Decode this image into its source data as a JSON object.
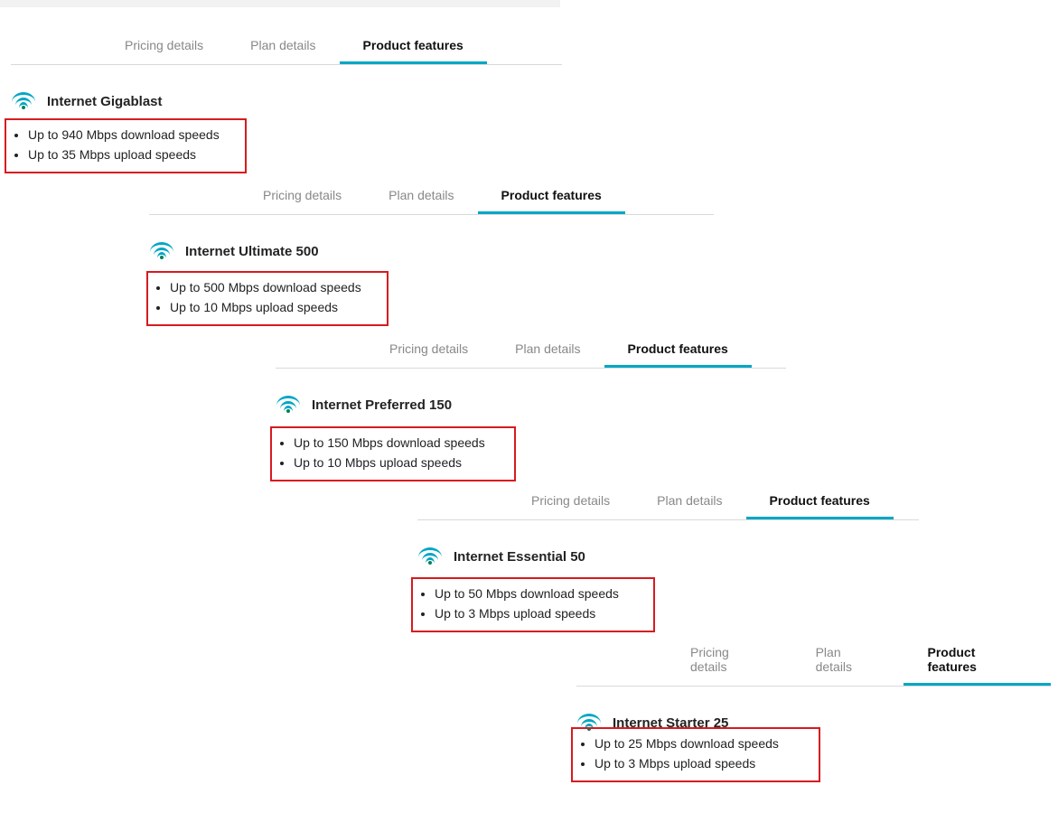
{
  "tabs": {
    "pricing": "Pricing details",
    "plan": "Plan details",
    "features": "Product features"
  },
  "plans": [
    {
      "name": "Internet Gigablast",
      "features": [
        "Up to 940 Mbps download speeds",
        "Up to 35 Mbps upload speeds"
      ]
    },
    {
      "name": "Internet Ultimate 500",
      "features": [
        "Up to 500 Mbps download speeds",
        "Up to 10 Mbps upload speeds"
      ]
    },
    {
      "name": "Internet Preferred 150",
      "features": [
        "Up to 150 Mbps download speeds",
        "Up to 10 Mbps upload speeds"
      ]
    },
    {
      "name": "Internet Essential 50",
      "features": [
        "Up to 50 Mbps download speeds",
        "Up to 3 Mbps upload speeds"
      ]
    },
    {
      "name": "Internet Starter 25",
      "features": [
        "Up to 25 Mbps download speeds",
        "Up to 3 Mbps upload speeds"
      ]
    }
  ]
}
